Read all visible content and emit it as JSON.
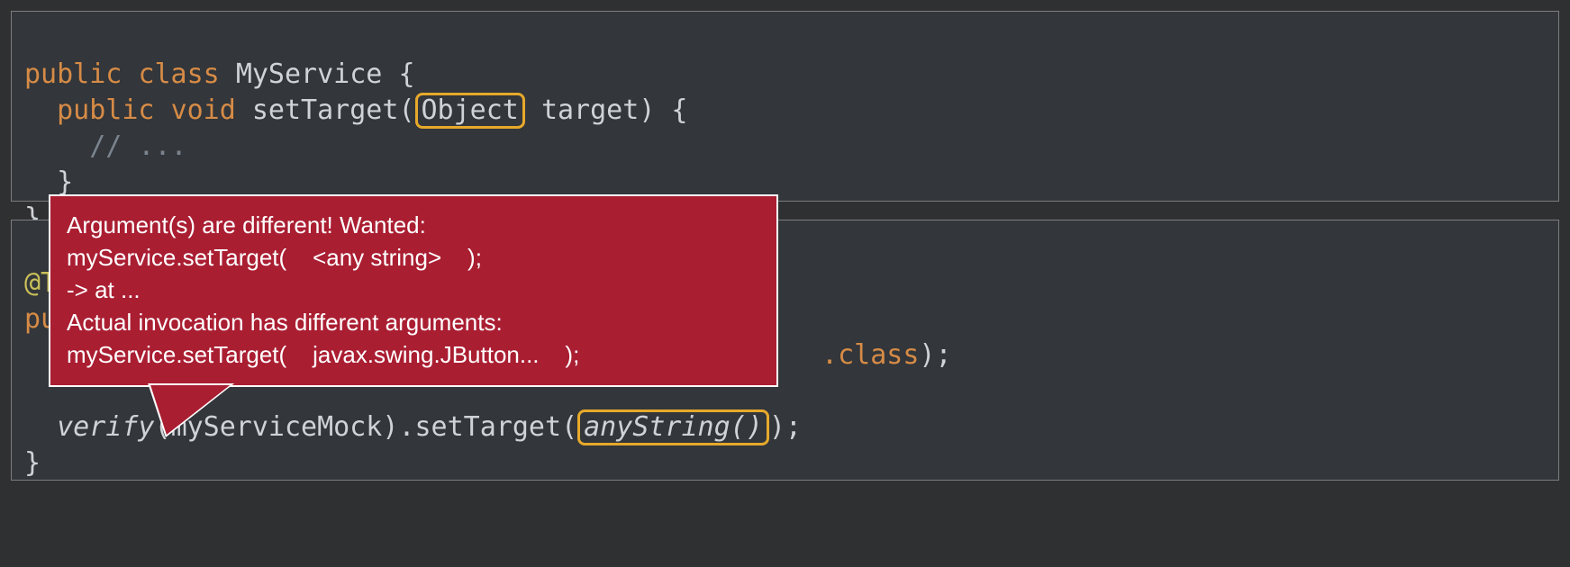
{
  "top": {
    "l1_public": "public",
    "l1_class": "class",
    "l1_name": "MyService",
    "l1_brace": "{",
    "l2_public": "public",
    "l2_void": "void",
    "l2_method": "setTarget",
    "l2_open": "(",
    "l2_param_type": "Object",
    "l2_param_name": "target",
    "l2_close_brace": ") {",
    "l3_comment": "// ...",
    "l4_brace": "}",
    "l5_brace": "}"
  },
  "bottom": {
    "l1_anno_frag": "@T",
    "l2_pu_frag": "pu",
    "l3_dot": ".",
    "l3_class": "class",
    "l3_close": ");",
    "l5_verify": "verify",
    "l5_open": "(",
    "l5_arg": "myServiceMock",
    "l5_close": ")",
    "l5_dot": ".",
    "l5_set": "setTarget",
    "l5_open2": "(",
    "l5_any": "anyString()",
    "l5_close2": ");",
    "l6_brace": "}"
  },
  "error": {
    "l1": "Argument(s) are different! Wanted:",
    "l2": "myService.setTarget(    <any string>    );",
    "l3": "-> at ...",
    "l4": "Actual invocation has different arguments:",
    "l5": "myService.setTarget(    javax.swing.JButton...    );"
  }
}
